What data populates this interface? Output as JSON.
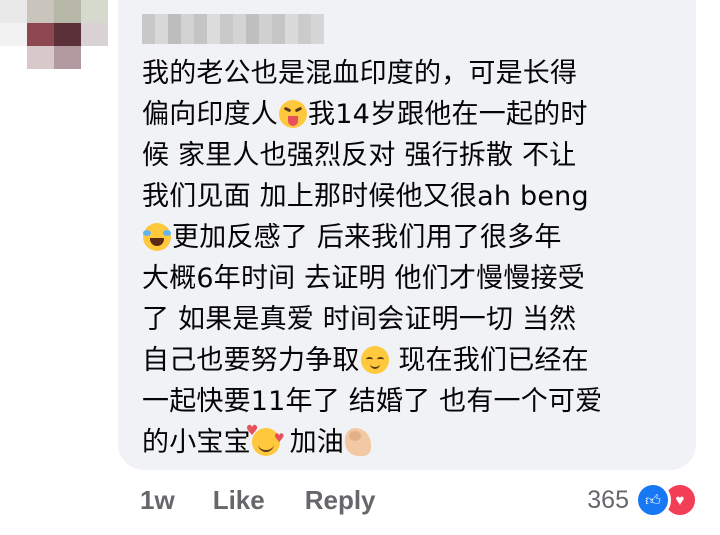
{
  "comment": {
    "lines": [
      "我的老公也是混血印度的，可是长得",
      "偏向印度人",
      "我14岁跟他在一起的时",
      "候 家里人也强烈反对 强行拆散 不让",
      "我们见面 加上那时候他又很ah beng",
      "更加反感了 后来我们用了很多年",
      "大概6年时间 去证明 他们才慢慢接受",
      "了 如果是真爱 时间会证明一切 当然",
      "自己也要努力争取",
      " 现在我们已经在",
      "一起快要11年了 结婚了 也有一个可爱",
      "的小宝宝",
      " 加油"
    ],
    "emojis": [
      "squinting-tongue-emoji",
      "laughing-tears-emoji",
      "relieved-face-emoji",
      "smiling-hearts-emoji",
      "flexed-biceps-emoji"
    ]
  },
  "actions": {
    "timestamp": "1w",
    "like_label": "Like",
    "reply_label": "Reply"
  },
  "reactions": {
    "count": "365",
    "types": [
      "like",
      "love"
    ]
  },
  "colors": {
    "bubble_bg": "#f0f2f5",
    "text": "#050505",
    "secondary_text": "#65676b",
    "like_blue": "#1877f2",
    "love_red": "#f33e58"
  }
}
